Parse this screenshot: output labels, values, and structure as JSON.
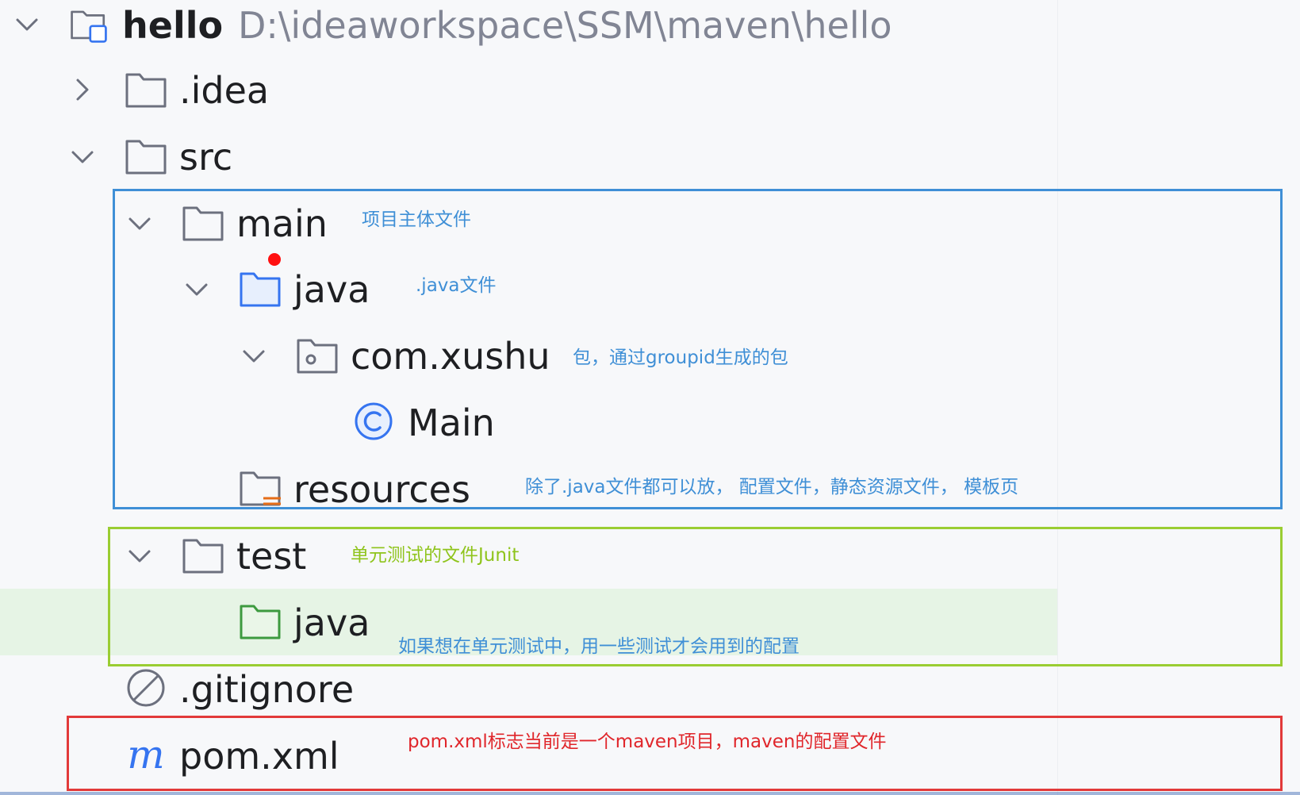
{
  "project": {
    "name": "hello",
    "path": "D:\\ideaworkspace\\SSM\\maven\\hello"
  },
  "tree": {
    "idea": ".idea",
    "src": "src",
    "main": "main",
    "main_java": "java",
    "package": "com.xushu",
    "main_class": "Main",
    "resources": "resources",
    "test": "test",
    "test_java": "java",
    "gitignore": ".gitignore",
    "pom": "pom.xml"
  },
  "annotations": {
    "main": "项目主体文件",
    "java": ".java文件",
    "package": "包，通过groupid生成的包",
    "resources": "除了.java文件都可以放，  配置文件，静态资源文件，  模板页",
    "test": "单元测试的文件Junit",
    "test_java": "如果想在单元测试中，用一些测试才会用到的配置",
    "pom": "pom.xml标志当前是一个maven项目，maven的配置文件"
  },
  "icons": {
    "project": "project-folder-icon",
    "folder": "folder-icon",
    "source_root": "source-root-folder-icon",
    "package": "package-folder-icon",
    "class": "java-class-icon",
    "resources": "resources-folder-icon",
    "test_root": "test-root-folder-icon",
    "gitignore": "ignore-file-icon",
    "maven": "maven-file-icon"
  },
  "colors": {
    "annotation_blue": "#3f8fd6",
    "annotation_green": "#8fc41c",
    "annotation_red": "#e0262b",
    "selection_bg": "#e6f4e5"
  }
}
